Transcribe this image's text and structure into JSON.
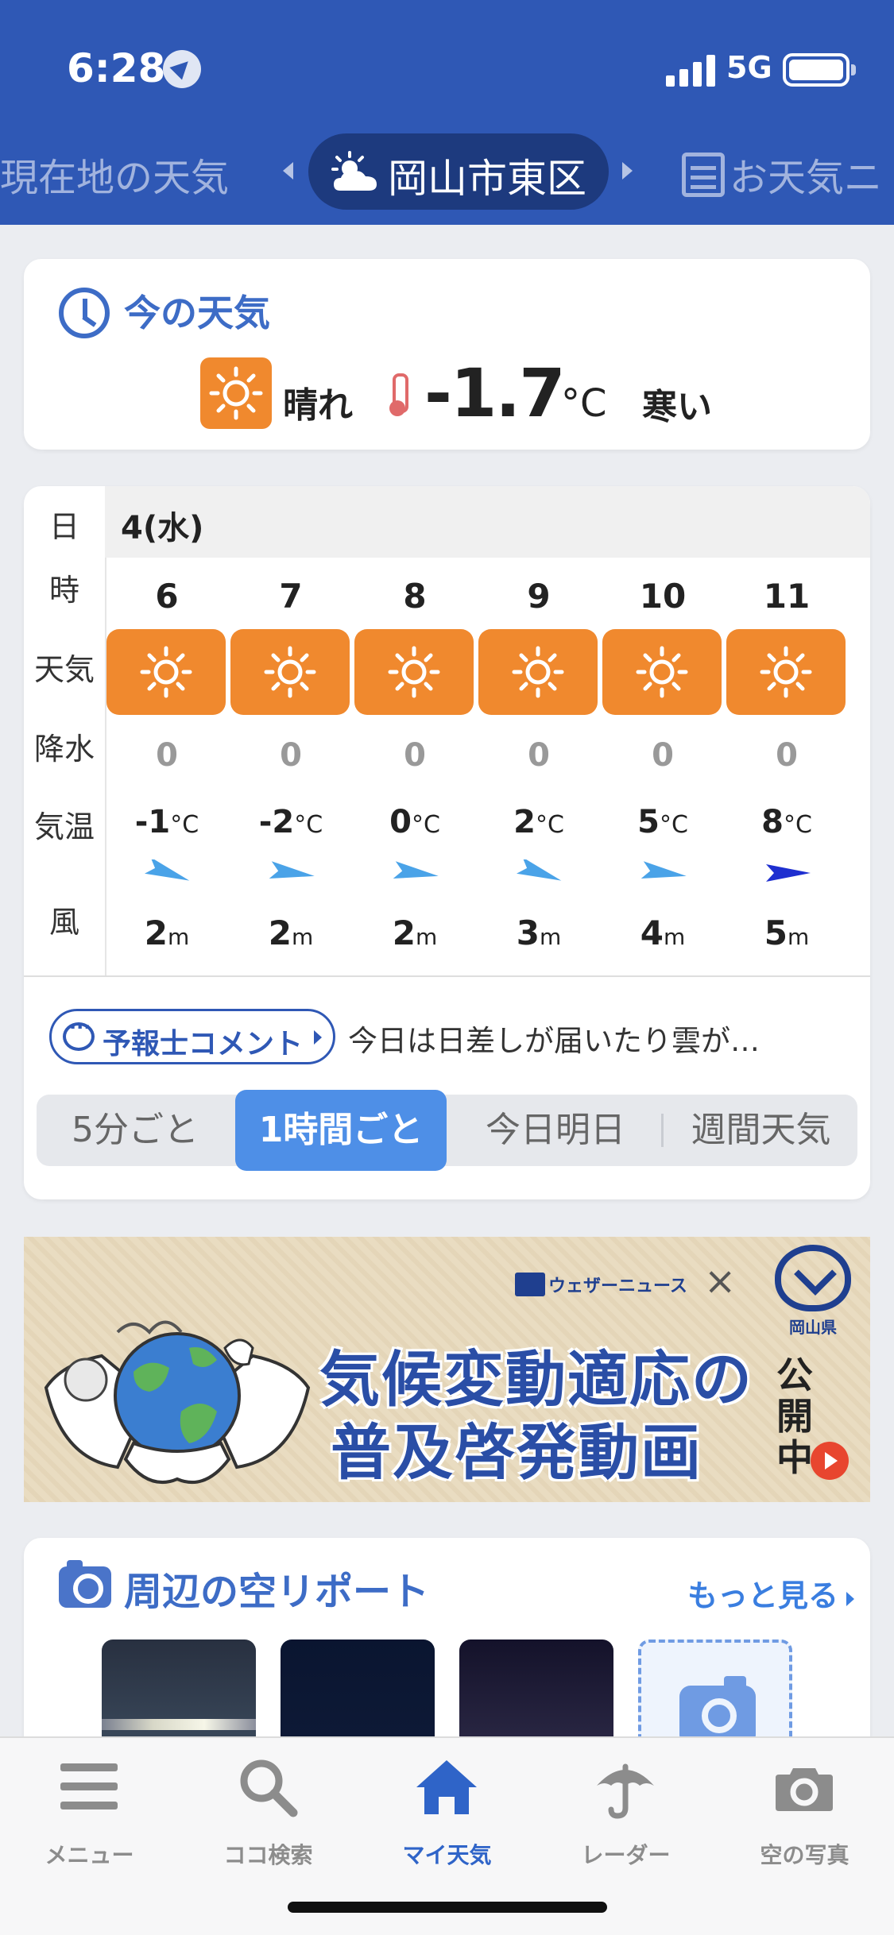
{
  "status_bar": {
    "time": "6:28",
    "network": "5G"
  },
  "location_tabs": {
    "left": "現在地の天気",
    "active": "岡山市東区",
    "right": "お天気ニ"
  },
  "now": {
    "title": "今の天気",
    "condition": "晴れ",
    "temperature": "-1.7",
    "unit": "°C",
    "feeling": "寒い",
    "icon": "sun-icon"
  },
  "forecast": {
    "row_labels": {
      "day": "日",
      "hour": "時",
      "weather": "天気",
      "rain": "降水",
      "temp": "気温",
      "wind": "風"
    },
    "date": "4(水)",
    "temp_unit": "°C",
    "wind_unit": "m",
    "hours": [
      {
        "hour": "6",
        "weather": "sun-icon",
        "rain": "0",
        "temp": "-1",
        "wind_speed": "2",
        "wind_dir_deg": 20,
        "wind_color": "#4aa3e8"
      },
      {
        "hour": "7",
        "weather": "sun-icon",
        "rain": "0",
        "temp": "-2",
        "wind_speed": "2",
        "wind_dir_deg": 8,
        "wind_color": "#4aa3e8"
      },
      {
        "hour": "8",
        "weather": "sun-icon",
        "rain": "0",
        "temp": "0",
        "wind_speed": "2",
        "wind_dir_deg": 8,
        "wind_color": "#4aa3e8"
      },
      {
        "hour": "9",
        "weather": "sun-icon",
        "rain": "0",
        "temp": "2",
        "wind_speed": "3",
        "wind_dir_deg": 20,
        "wind_color": "#4aa3e8"
      },
      {
        "hour": "10",
        "weather": "sun-icon",
        "rain": "0",
        "temp": "5",
        "wind_speed": "4",
        "wind_dir_deg": 8,
        "wind_color": "#4aa3e8"
      },
      {
        "hour": "11",
        "weather": "sun-icon",
        "rain": "0",
        "temp": "8",
        "wind_speed": "5",
        "wind_dir_deg": 0,
        "wind_color": "#1e2fd0"
      }
    ],
    "comment_button": "予報士コメント",
    "comment_text": "今日は日差しが届いたり雲が…",
    "segments": [
      "5分ごと",
      "1時間ごと",
      "今日明日",
      "週間天気"
    ],
    "active_segment": "1時間ごと"
  },
  "ad": {
    "brand": "ウェザーニュース",
    "cross": "×",
    "prefecture": "岡山県",
    "headline_1": "気候変動適応の",
    "headline_2": "普及啓発動画",
    "badge": "公開中"
  },
  "sky_report": {
    "title": "周辺の空リポート",
    "more": "もっと見る"
  },
  "nav": [
    {
      "label": "メニュー",
      "icon": "menu-icon"
    },
    {
      "label": "ココ検索",
      "icon": "search-icon"
    },
    {
      "label": "マイ天気",
      "icon": "home-icon",
      "active": true
    },
    {
      "label": "レーダー",
      "icon": "umbrella-icon"
    },
    {
      "label": "空の写真",
      "icon": "camera-icon"
    }
  ],
  "colors": {
    "header": "#2f58b5",
    "sun_orange": "#f0892e",
    "accent": "#3d6cc6",
    "segment_active": "#4e8fe7"
  }
}
